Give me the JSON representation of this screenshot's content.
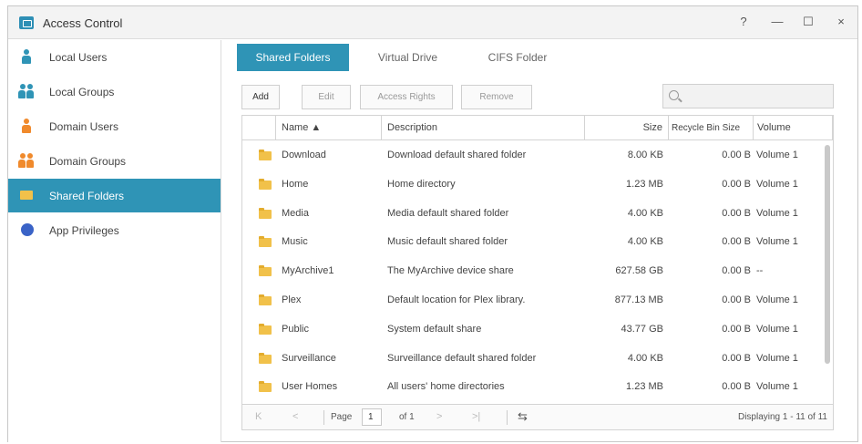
{
  "window": {
    "title": "Access Control",
    "controls": {
      "help": "?",
      "minimize": "—",
      "maximize": "☐",
      "close": "×"
    }
  },
  "sidebar": {
    "items": [
      {
        "label": "Local Users",
        "icon": "user-icon",
        "color": "#2f94b6",
        "active": false
      },
      {
        "label": "Local Groups",
        "icon": "users-icon",
        "color": "#2f94b6",
        "active": false
      },
      {
        "label": "Domain Users",
        "icon": "user-icon",
        "color": "#f08a2c",
        "active": false
      },
      {
        "label": "Domain Groups",
        "icon": "users-icon",
        "color": "#f08a2c",
        "active": false
      },
      {
        "label": "Shared Folders",
        "icon": "folder-icon",
        "color": "#f1c14a",
        "active": true
      },
      {
        "label": "App Privileges",
        "icon": "app-icon",
        "color": "#3a63c7",
        "active": false
      }
    ]
  },
  "tabs": [
    {
      "label": "Shared Folders",
      "active": true
    },
    {
      "label": "Virtual Drive",
      "active": false
    },
    {
      "label": "CIFS Folder",
      "active": false
    }
  ],
  "toolbar": {
    "add": "Add",
    "edit": "Edit",
    "access_rights": "Access Rights",
    "remove": "Remove",
    "search_placeholder": ""
  },
  "table": {
    "headers": {
      "name": "Name ▲",
      "description": "Description",
      "size": "Size",
      "recycle": "Recycle Bin Size",
      "volume": "Volume"
    },
    "rows": [
      {
        "name": "Download",
        "description": "Download default shared folder",
        "size": "8.00 KB",
        "recycle": "0.00 B",
        "volume": "Volume 1"
      },
      {
        "name": "Home",
        "description": "Home directory",
        "size": "1.23 MB",
        "recycle": "0.00 B",
        "volume": "Volume 1"
      },
      {
        "name": "Media",
        "description": "Media default shared folder",
        "size": "4.00 KB",
        "recycle": "0.00 B",
        "volume": "Volume 1"
      },
      {
        "name": "Music",
        "description": "Music default shared folder",
        "size": "4.00 KB",
        "recycle": "0.00 B",
        "volume": "Volume 1"
      },
      {
        "name": "MyArchive1",
        "description": "The MyArchive device share",
        "size": "627.58 GB",
        "recycle": "0.00 B",
        "volume": "--"
      },
      {
        "name": "Plex",
        "description": "Default location for Plex library.",
        "size": "877.13 MB",
        "recycle": "0.00 B",
        "volume": "Volume 1"
      },
      {
        "name": "Public",
        "description": "System default share",
        "size": "43.77 GB",
        "recycle": "0.00 B",
        "volume": "Volume 1"
      },
      {
        "name": "Surveillance",
        "description": "Surveillance default shared folder",
        "size": "4.00 KB",
        "recycle": "0.00 B",
        "volume": "Volume 1"
      },
      {
        "name": "User Homes",
        "description": "All users' home directories",
        "size": "1.23 MB",
        "recycle": "0.00 B",
        "volume": "Volume 1"
      }
    ]
  },
  "pager": {
    "first": "K",
    "prev": "<",
    "page_label": "Page",
    "page_value": "1",
    "of_label": "of 1",
    "next": ">",
    "last": ">|",
    "refresh": "⇆",
    "display": "Displaying 1 - 11 of 11"
  }
}
